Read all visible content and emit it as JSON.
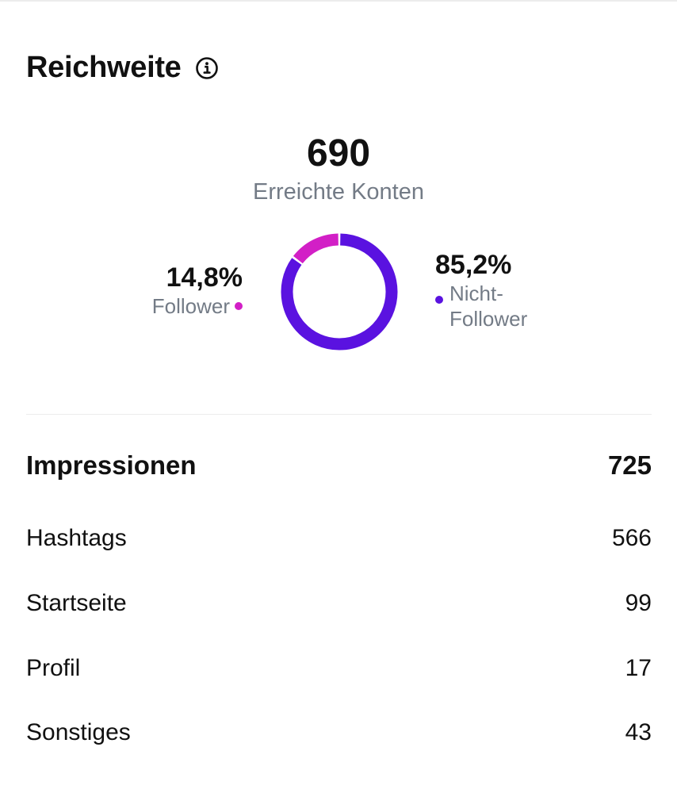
{
  "reach": {
    "title": "Reichweite",
    "total": "690",
    "total_caption": "Erreichte Konten",
    "follower": {
      "percent": "14,8%",
      "label": "Follower",
      "share": 0.148,
      "color": "#d21fc6"
    },
    "non_follower": {
      "percent": "85,2%",
      "label_line1": "Nicht-",
      "label_line2": "Follower",
      "share": 0.852,
      "color": "#5a12e0"
    },
    "info_icon": "info-circle-icon"
  },
  "impressions": {
    "label": "Impressionen",
    "total": "725",
    "breakdown": [
      {
        "label": "Hashtags",
        "value": "566"
      },
      {
        "label": "Startseite",
        "value": "99"
      },
      {
        "label": "Profil",
        "value": "17"
      },
      {
        "label": "Sonstiges",
        "value": "43"
      }
    ]
  }
}
